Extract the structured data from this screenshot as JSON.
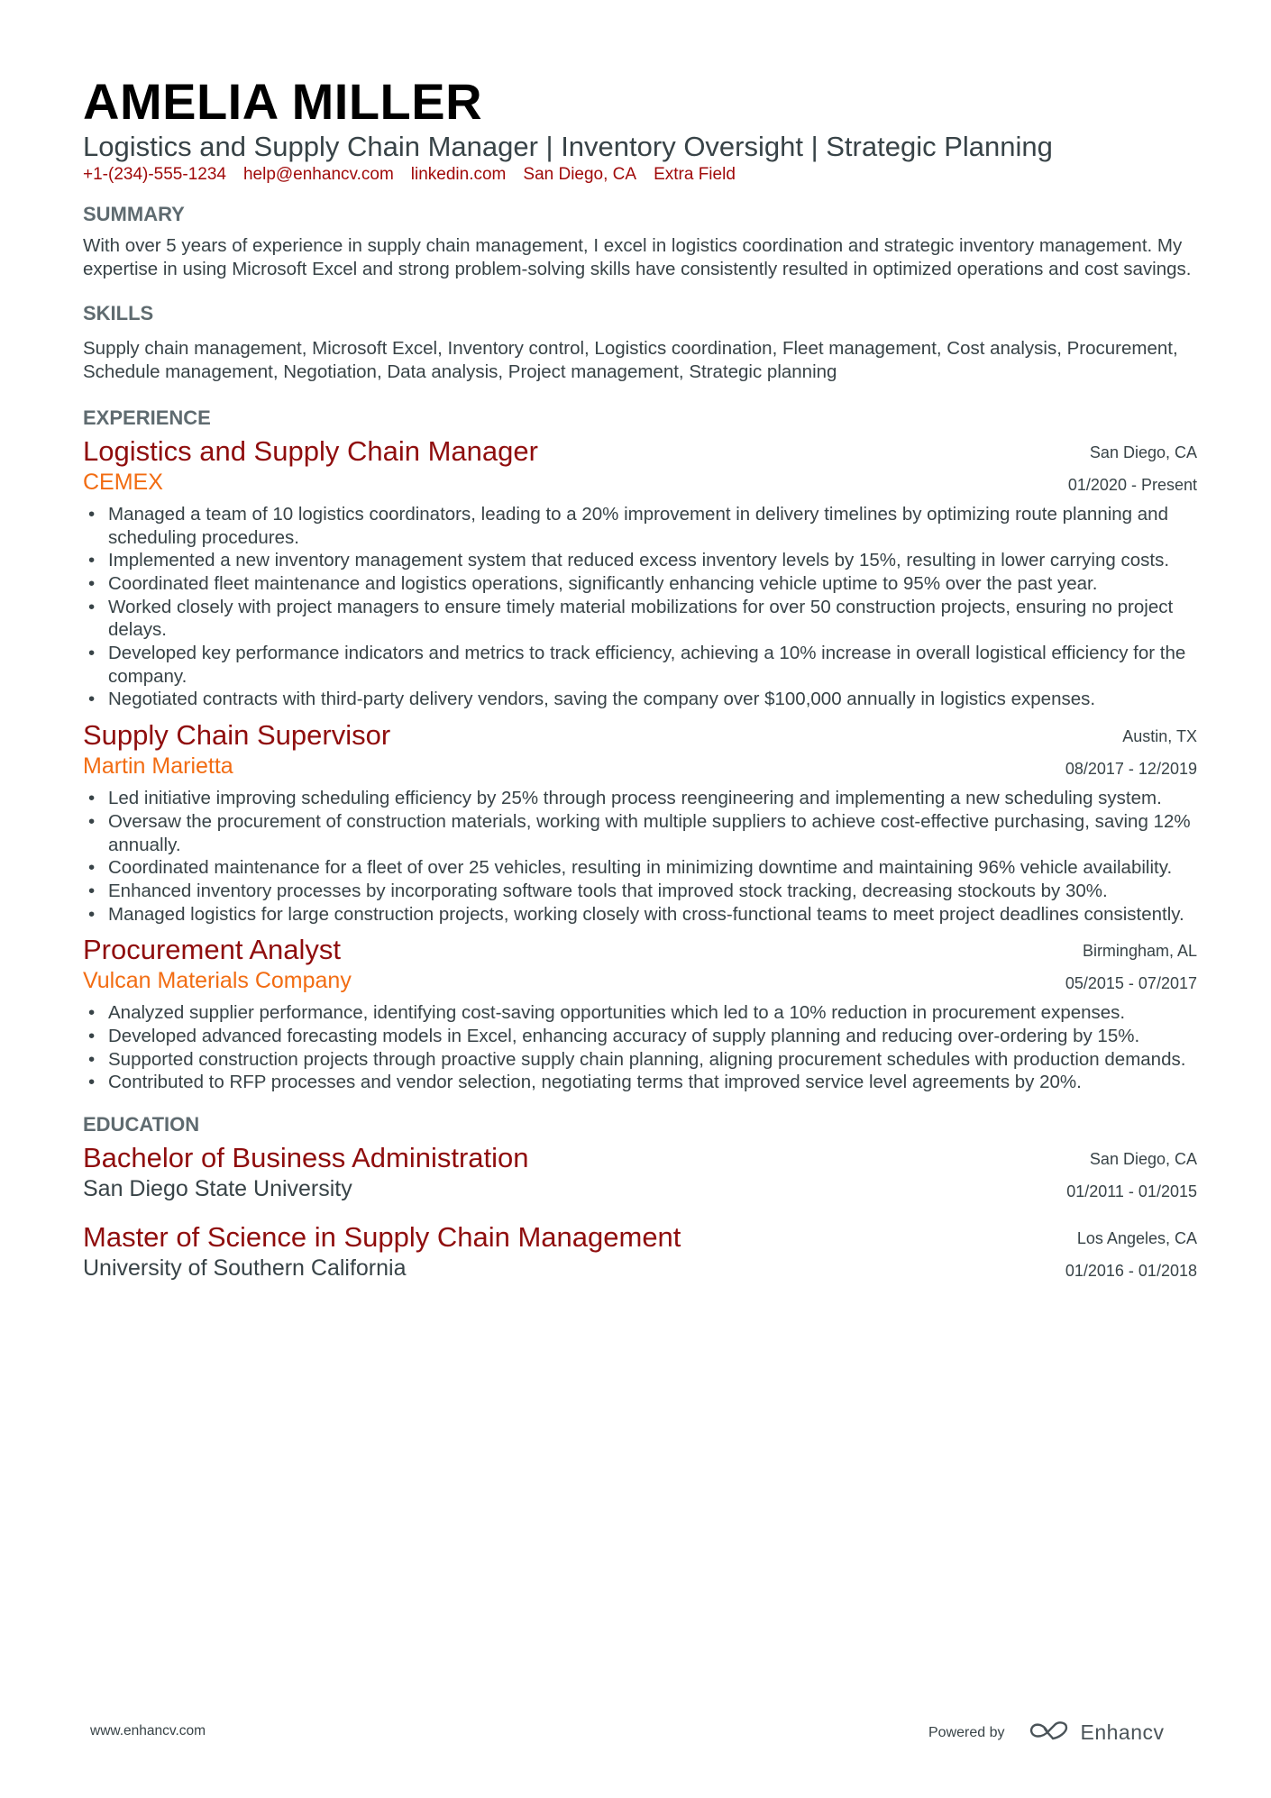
{
  "header": {
    "name": "AMELIA MILLER",
    "tagline": "Logistics and Supply Chain Manager | Inventory Oversight | Strategic Planning",
    "contact": [
      "+1-(234)-555-1234",
      "help@enhancv.com",
      "linkedin.com",
      "San Diego, CA",
      "Extra Field"
    ]
  },
  "summary": {
    "title": "SUMMARY",
    "text": "With over 5 years of experience in supply chain management, I excel in logistics coordination and strategic inventory management. My expertise in using Microsoft Excel and strong problem-solving skills have consistently resulted in optimized operations and cost savings."
  },
  "skills": {
    "title": "SKILLS",
    "text": "Supply chain management, Microsoft Excel, Inventory control, Logistics coordination, Fleet management, Cost analysis, Procurement, Schedule management, Negotiation, Data analysis, Project management, Strategic planning"
  },
  "experience": {
    "title": "EXPERIENCE",
    "entries": [
      {
        "role": "Logistics and Supply Chain Manager",
        "company": "CEMEX",
        "location": "San Diego, CA",
        "dates": "01/2020 - Present",
        "bullets": [
          "Managed a team of 10 logistics coordinators, leading to a 20% improvement in delivery timelines by optimizing route planning and scheduling procedures.",
          "Implemented a new inventory management system that reduced excess inventory levels by 15%, resulting in lower carrying costs.",
          "Coordinated fleet maintenance and logistics operations, significantly enhancing vehicle uptime to 95% over the past year.",
          "Worked closely with project managers to ensure timely material mobilizations for over 50 construction projects, ensuring no project delays.",
          "Developed key performance indicators and metrics to track efficiency, achieving a 10% increase in overall logistical efficiency for the company.",
          "Negotiated contracts with third-party delivery vendors, saving the company over $100,000 annually in logistics expenses."
        ]
      },
      {
        "role": "Supply Chain Supervisor",
        "company": "Martin Marietta",
        "location": "Austin, TX",
        "dates": "08/2017 - 12/2019",
        "bullets": [
          "Led initiative improving scheduling efficiency by 25% through process reengineering and implementing a new scheduling system.",
          "Oversaw the procurement of construction materials, working with multiple suppliers to achieve cost-effective purchasing, saving 12% annually.",
          "Coordinated maintenance for a fleet of over 25 vehicles, resulting in minimizing downtime and maintaining 96% vehicle availability.",
          "Enhanced inventory processes by incorporating software tools that improved stock tracking, decreasing stockouts by 30%.",
          "Managed logistics for large construction projects, working closely with cross-functional teams to meet project deadlines consistently."
        ]
      },
      {
        "role": "Procurement Analyst",
        "company": "Vulcan Materials Company",
        "location": "Birmingham, AL",
        "dates": "05/2015 - 07/2017",
        "bullets": [
          "Analyzed supplier performance, identifying cost-saving opportunities which led to a 10% reduction in procurement expenses.",
          "Developed advanced forecasting models in Excel, enhancing accuracy of supply planning and reducing over-ordering by 15%.",
          "Supported construction projects through proactive supply chain planning, aligning procurement schedules with production demands.",
          "Contributed to RFP processes and vendor selection, negotiating terms that improved service level agreements by 20%."
        ]
      }
    ]
  },
  "education": {
    "title": "EDUCATION",
    "entries": [
      {
        "degree": "Bachelor of Business Administration",
        "school": "San Diego State University",
        "location": "San Diego, CA",
        "dates": "01/2011 - 01/2015"
      },
      {
        "degree": "Master of Science in Supply Chain Management",
        "school": "University of Southern California",
        "location": "Los Angeles, CA",
        "dates": "01/2016 - 01/2018"
      }
    ]
  },
  "footer": {
    "url": "www.enhancv.com",
    "powered_by": "Powered by",
    "brand": "Enhancv",
    "brand_icon": "enhancv-logo-icon"
  },
  "colors": {
    "accent_dark_red": "#8f0d0d",
    "contact_red": "#a00a0a",
    "company_orange": "#f26c12",
    "heading_gray": "#5f6b70",
    "body_text": "#384347"
  }
}
